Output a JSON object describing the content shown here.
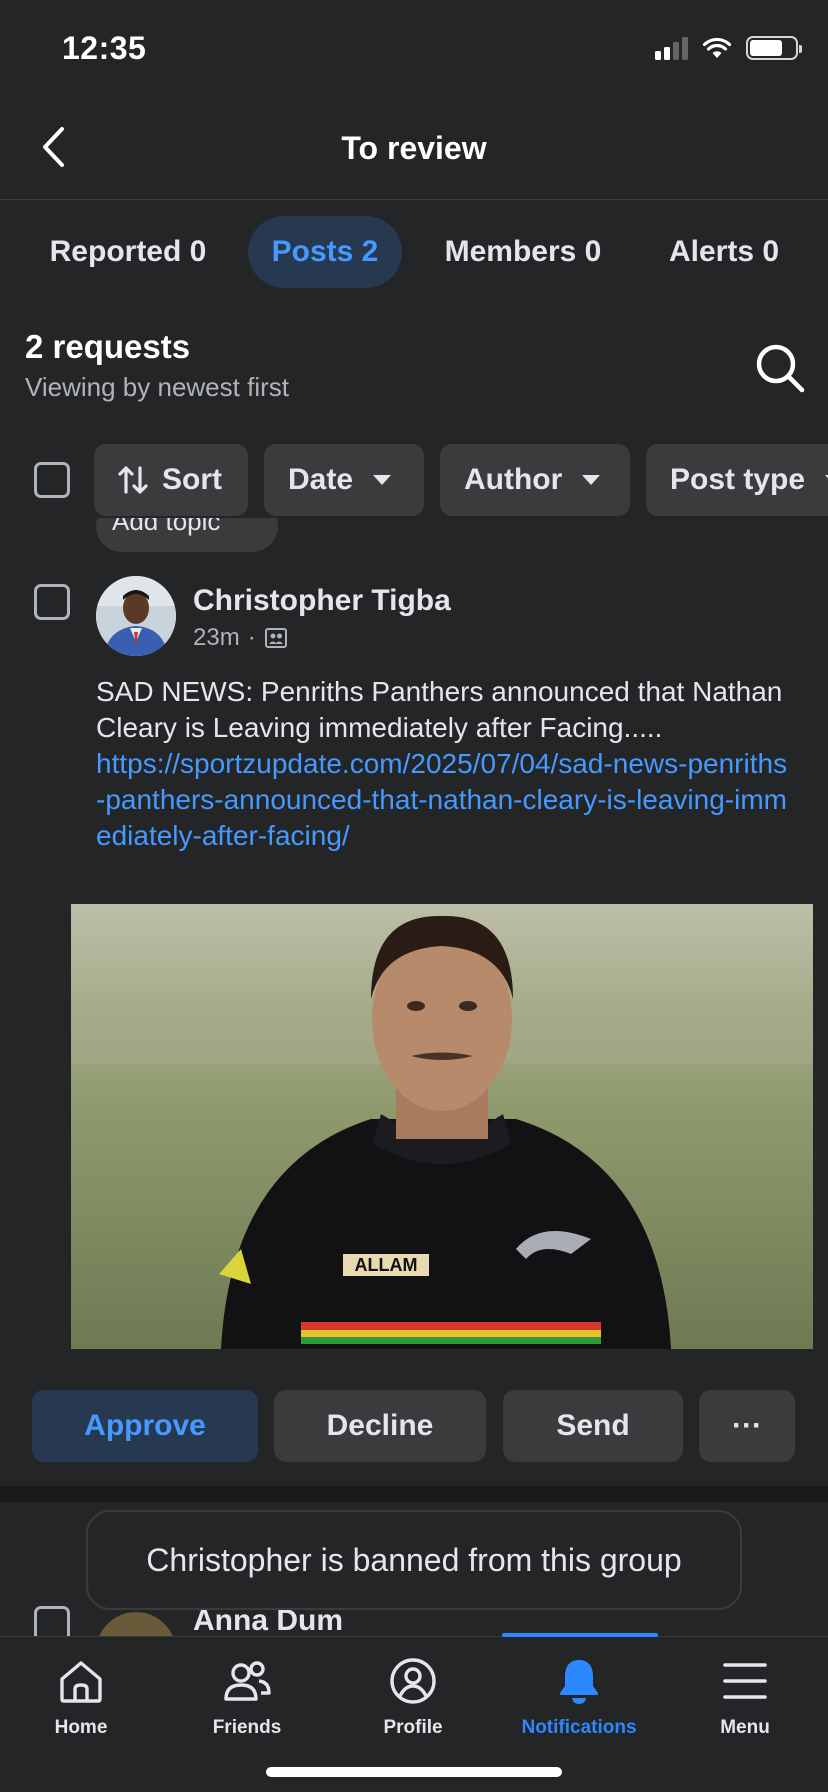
{
  "status_bar": {
    "time": "12:35",
    "battery_level": 0.72,
    "signal_bars": 2
  },
  "header": {
    "title": "To review",
    "back_icon": "chevron-left-icon"
  },
  "tabs": [
    {
      "label": "Reported 0",
      "active": false
    },
    {
      "label": "Posts 2",
      "active": true
    },
    {
      "label": "Members 0",
      "active": false
    },
    {
      "label": "Alerts 0",
      "active": false
    }
  ],
  "summary": {
    "count_label": "2 requests",
    "sort_description": "Viewing by newest first",
    "search_icon": "search-icon"
  },
  "filters": {
    "sort_label": "Sort",
    "date_label": "Date",
    "author_label": "Author",
    "post_type_label": "Post type"
  },
  "topic_chip": {
    "label": "Add topic"
  },
  "post": {
    "author": "Christopher Tigba",
    "time": "23m",
    "separator": "·",
    "audience_icon": "group-icon",
    "text": "SAD NEWS: Penriths Panthers announced that Nathan Cleary is Leaving immediately after Facing.....",
    "link": "https://sportzupdate.com/2025/07/04/sad-news-penriths-panthers-announced-that-nathan-cleary-is-leaving-immediately-after-facing/"
  },
  "actions": {
    "approve": "Approve",
    "decline": "Decline",
    "send": "Send",
    "more": "···"
  },
  "toast": {
    "message": "Christopher is banned from this group"
  },
  "next_post": {
    "author": "Anna Dum"
  },
  "bottom_nav": [
    {
      "label": "Home",
      "icon": "home-icon",
      "active": false
    },
    {
      "label": "Friends",
      "icon": "friends-icon",
      "active": false
    },
    {
      "label": "Profile",
      "icon": "profile-icon",
      "active": false
    },
    {
      "label": "Notifications",
      "icon": "bell-icon",
      "active": true
    },
    {
      "label": "Menu",
      "icon": "menu-icon",
      "active": false
    }
  ],
  "colors": {
    "accent": "#4599ff",
    "active_chip_bg": "#263951",
    "background": "#242526",
    "chip_bg": "#3a3b3c"
  }
}
